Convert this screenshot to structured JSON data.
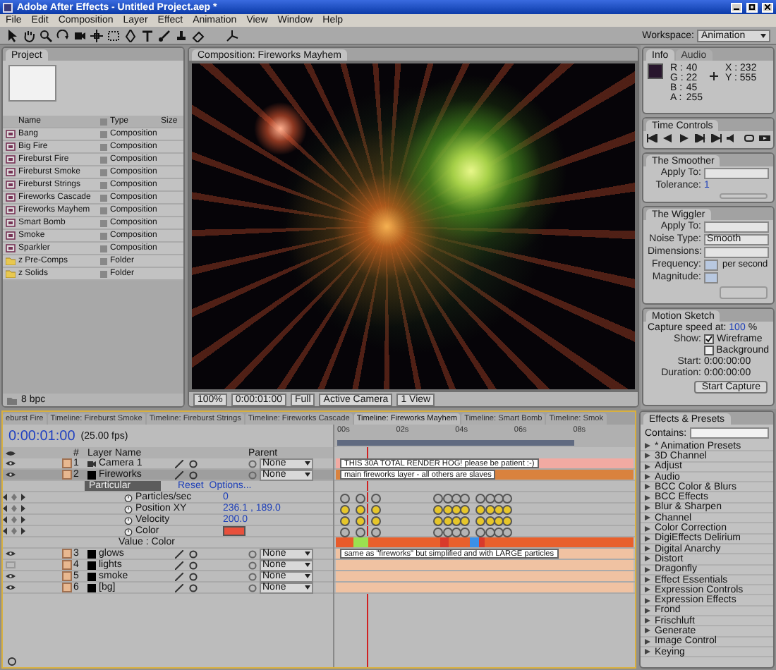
{
  "window": {
    "title": "Adobe After Effects - Untitled Project.aep *"
  },
  "menu": [
    "File",
    "Edit",
    "Composition",
    "Layer",
    "Effect",
    "Animation",
    "View",
    "Window",
    "Help"
  ],
  "workspace": {
    "label": "Workspace:",
    "value": "Animation"
  },
  "project": {
    "tab": "Project",
    "columns": [
      "Name",
      "Type",
      "Size"
    ],
    "depth": "8 bpc",
    "items": [
      {
        "name": "Bang",
        "type": "Composition",
        "kind": "comp"
      },
      {
        "name": "Big Fire",
        "type": "Composition",
        "kind": "comp"
      },
      {
        "name": "Fireburst Fire",
        "type": "Composition",
        "kind": "comp"
      },
      {
        "name": "Fireburst Smoke",
        "type": "Composition",
        "kind": "comp"
      },
      {
        "name": "Fireburst Strings",
        "type": "Composition",
        "kind": "comp"
      },
      {
        "name": "Fireworks Cascade",
        "type": "Composition",
        "kind": "comp"
      },
      {
        "name": "Fireworks Mayhem",
        "type": "Composition",
        "kind": "comp"
      },
      {
        "name": "Smart Bomb",
        "type": "Composition",
        "kind": "comp"
      },
      {
        "name": "Smoke",
        "type": "Composition",
        "kind": "comp"
      },
      {
        "name": "Sparkler",
        "type": "Composition",
        "kind": "comp"
      },
      {
        "name": "z Pre-Comps",
        "type": "Folder",
        "kind": "folder"
      },
      {
        "name": "z Solids",
        "type": "Folder",
        "kind": "folder"
      }
    ]
  },
  "composition": {
    "tab": "Composition: Fireworks Mayhem",
    "zoom": "100%",
    "time": "0:00:01:00",
    "resolution": "Full",
    "camera": "Active Camera",
    "views": "1 View"
  },
  "info": {
    "tabs": [
      {
        "label": "Info",
        "selected": true
      },
      {
        "label": "Audio",
        "selected": false
      }
    ],
    "channels": [
      {
        "label": "R :",
        "value": "40"
      },
      {
        "label": "G :",
        "value": "22"
      },
      {
        "label": "B :",
        "value": "45"
      },
      {
        "label": "A :",
        "value": "255"
      }
    ],
    "coords": [
      "X : 232",
      "Y : 555"
    ]
  },
  "time_controls": {
    "title": "Time Controls"
  },
  "smoother": {
    "title": "The Smoother",
    "apply_label": "Apply To:",
    "tolerance_label": "Tolerance:",
    "tolerance": "1"
  },
  "wiggler": {
    "title": "The Wiggler",
    "apply_label": "Apply To:",
    "noise_label": "Noise Type:",
    "noise": "Smooth",
    "dimensions_label": "Dimensions:",
    "frequency_label": "Frequency:",
    "frequency_unit": "per second",
    "magnitude_label": "Magnitude:"
  },
  "motion_sketch": {
    "title": "Motion Sketch",
    "capture_label": "Capture speed at:",
    "capture": "100",
    "capture_unit": "%",
    "show_label": "Show:",
    "options": [
      {
        "label": "Wireframe",
        "checked": true
      },
      {
        "label": "Background",
        "checked": false
      }
    ],
    "start_label": "Start:",
    "start": "0:00:00:00",
    "duration_label": "Duration:",
    "duration": "0:00:00:00",
    "button": "Start Capture"
  },
  "timeline": {
    "tabs": [
      {
        "label": "eburst Fire",
        "selected": false
      },
      {
        "label": "Timeline: Fireburst Smoke",
        "selected": false
      },
      {
        "label": "Timeline: Fireburst Strings",
        "selected": false
      },
      {
        "label": "Timeline: Fireworks Cascade",
        "selected": false
      },
      {
        "label": "Timeline: Fireworks Mayhem",
        "selected": true
      },
      {
        "label": "Timeline: Smart Bomb",
        "selected": false
      },
      {
        "label": "Timeline: Smok",
        "selected": false
      }
    ],
    "time": "0:00:01:00",
    "fps": "(25.00 fps)",
    "columns": [
      "#",
      "Layer Name",
      "Parent"
    ],
    "ruler": [
      "00s",
      "02s",
      "04s",
      "06s",
      "08s"
    ],
    "playhead": {
      "level": 0.11
    },
    "rows": [
      {
        "kind": "camera",
        "index": "1",
        "name": "Camera 1",
        "visible": true,
        "selected": false,
        "parent": "None",
        "color": "#f2aaa2",
        "comment": "THIS 30A TOTAL RENDER HOG! please be patient :-)"
      },
      {
        "kind": "solid",
        "index": "2",
        "name": "Fireworks",
        "visible": true,
        "selected": true,
        "parent": "None",
        "color": "#d9823e",
        "comment": "main fireworks layer - all others are slaves"
      },
      {
        "kind": "effect",
        "name": "Particular",
        "reset": "Reset",
        "options": "Options..."
      },
      {
        "kind": "property",
        "name": "Particles/sec",
        "value": "0",
        "color": "#b4b4b4"
      },
      {
        "kind": "property",
        "name": "Position XY",
        "value": "236.1 , 189.0",
        "color": "#e6c62a"
      },
      {
        "kind": "property",
        "name": "Velocity",
        "value": "200.0",
        "color": "#e6c62a"
      },
      {
        "kind": "property",
        "name": "Color",
        "swatch": {
          "color": "#e8503c"
        },
        "color": "#b4b4b4"
      },
      {
        "kind": "value",
        "name": "Value : Color"
      },
      {
        "kind": "solid",
        "index": "3",
        "name": "glows",
        "visible": true,
        "selected": false,
        "parent": "None",
        "color": "#f0c2a2",
        "comment": "same as \"fireworks\" but simplified and with LARGE particles"
      },
      {
        "kind": "solid",
        "index": "4",
        "name": "lights",
        "visible": false,
        "selected": false,
        "parent": "None",
        "color": "#f0c2a2"
      },
      {
        "kind": "solid",
        "index": "5",
        "name": "smoke",
        "visible": true,
        "selected": false,
        "parent": "None",
        "color": "#f0c2a2"
      },
      {
        "kind": "solid",
        "index": "6",
        "name": "[bg]",
        "visible": true,
        "selected": false,
        "parent": "None",
        "color": "#f0c2a2"
      }
    ]
  },
  "effects": {
    "title": "Effects & Presets",
    "search_label": "Contains:",
    "items": [
      "* Animation Presets",
      "3D Channel",
      "Adjust",
      "Audio",
      "BCC Color & Blurs",
      "BCC Effects",
      "Blur & Sharpen",
      "Channel",
      "Color Correction",
      "DigiEffects Delirium",
      "Digital Anarchy",
      "Distort",
      "Dragonfly",
      "Effect Essentials",
      "Expression Controls",
      "Expression Effects",
      "Frond",
      "Frischluft",
      "Generate",
      "Image Control",
      "Keying"
    ]
  }
}
